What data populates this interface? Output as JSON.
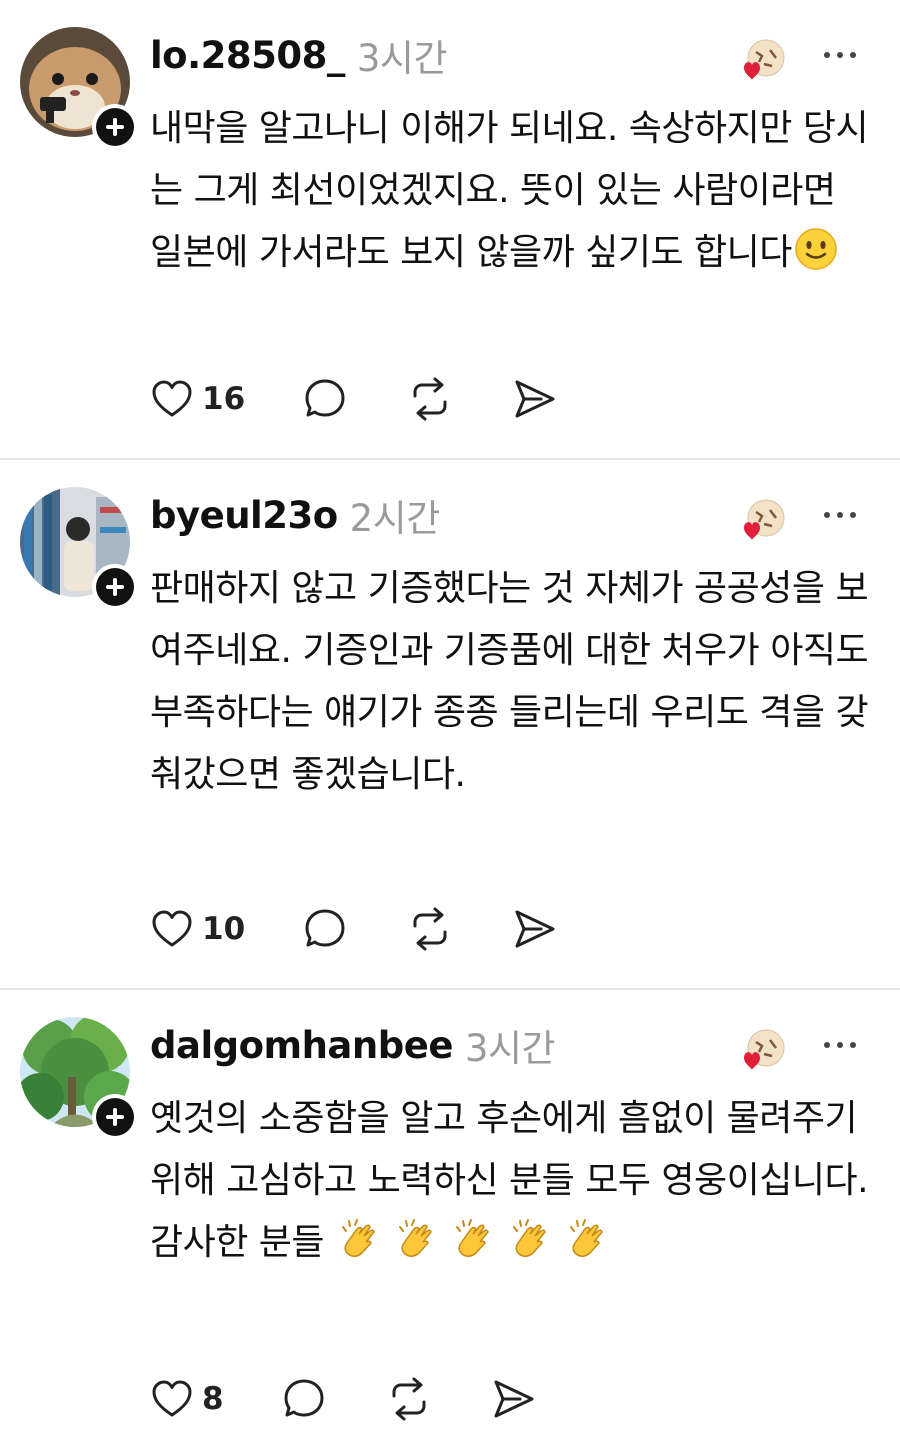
{
  "colors": {
    "text": "#111111",
    "muted": "#9a9a9a",
    "divider": "#e6e6e6",
    "heart": "#e0203a"
  },
  "posts": [
    {
      "username": "lo.28508_",
      "time": "3시간",
      "text": "내막을 알고나니 이해가 되네요. 속상하지만 당시는 그게 최선이었겠지요. 뜻이 있는 사람이라면 일본에 가서라도 보지 않을까 싶기도 합니다",
      "emoji_icons": [
        "slightly-smiling-face-icon"
      ],
      "likes": "16"
    },
    {
      "username": "byeul23o",
      "time": "2시간",
      "text": "판매하지 않고 기증했다는 것 자체가 공공성을 보여주네요. 기증인과 기증품에 대한 처우가 아직도 부족하다는 얘기가 종종 들리는데 우리도 격을 갖춰갔으면 좋겠습니다.",
      "emoji_icons": [],
      "likes": "10"
    },
    {
      "username": "dalgomhanbee",
      "time": "3시간",
      "text": "옛것의 소중함을 알고 후손에게 흠없이 물려주기 위해 고심하고 노력하신 분들 모두 영웅이십니다. 감사한 분들",
      "emoji_icons": [
        "clapping-hands-icon",
        "clapping-hands-icon",
        "clapping-hands-icon",
        "clapping-hands-icon",
        "clapping-hands-icon"
      ],
      "likes": "8"
    }
  ]
}
